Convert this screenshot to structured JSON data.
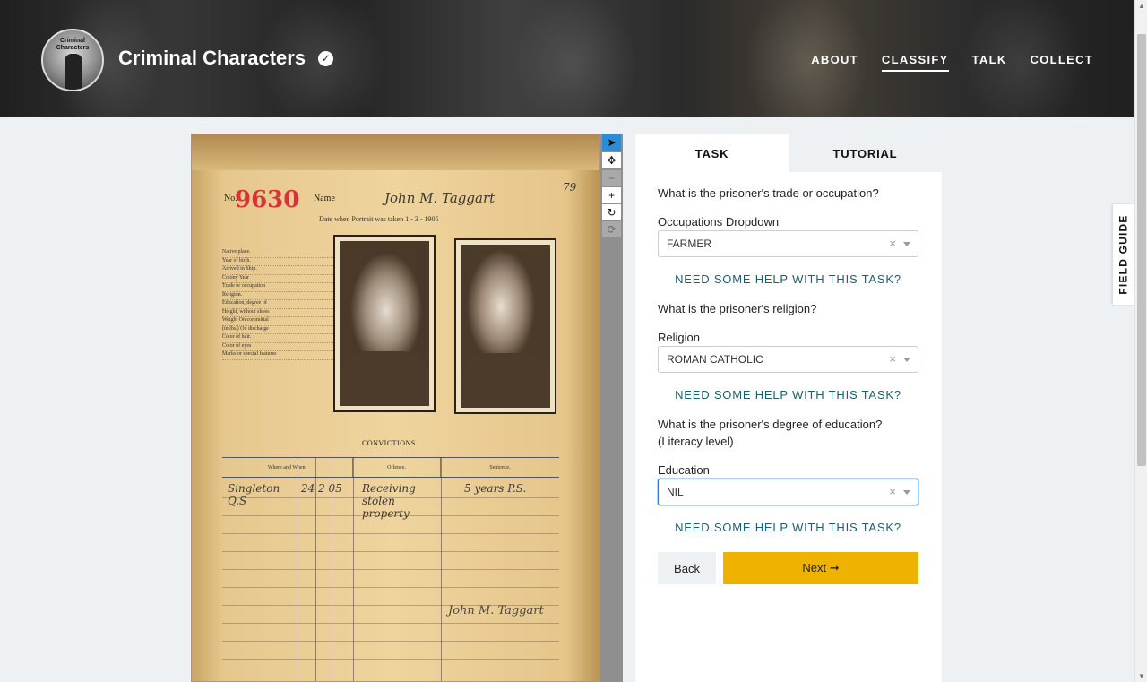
{
  "header": {
    "project_title": "Criminal Characters",
    "logo_text": "Criminal Characters",
    "nav": [
      {
        "label": "ABOUT"
      },
      {
        "label": "CLASSIFY"
      },
      {
        "label": "TALK"
      },
      {
        "label": "COLLECT"
      }
    ]
  },
  "subject": {
    "no_label": "No.",
    "register_number": "9630",
    "name_label": "Name",
    "handwritten_name": "John M. Taggart",
    "page_number": "79",
    "date_line": "Date when Portrait was taken  1 - 3 - 1905",
    "form_fields": [
      "Native place.",
      "Year of birth.",
      "Arrived in Ship.",
      "Colony  Year",
      "Trade or occupation",
      "Religion.",
      "Education, degree of",
      "Height, without shoes",
      "Weight On committal",
      "(in lbs.) On discharge",
      "Color of hair.",
      "Color of eyes",
      "Marks or special features"
    ],
    "convictions_heading": "CONVICTIONS.",
    "table_headers": [
      "Where and When.",
      "Offence.",
      "Sentence."
    ],
    "conviction_place": "Singleton Q.S",
    "conviction_date": "24  2  05",
    "conviction_offence": "Receiving stolen property",
    "conviction_sentence": "5 years P.S.",
    "signature": "John M. Taggart"
  },
  "toolbar": {
    "tools": [
      {
        "icon": "pointer-icon",
        "glyph": "➤"
      },
      {
        "icon": "move-icon",
        "glyph": "✥"
      },
      {
        "icon": "zoom-out-icon",
        "glyph": "−"
      },
      {
        "icon": "zoom-in-icon",
        "glyph": "+"
      },
      {
        "icon": "rotate-icon",
        "glyph": "↻"
      },
      {
        "icon": "reset-icon",
        "glyph": "⟳"
      }
    ]
  },
  "panel": {
    "tabs": [
      {
        "label": "TASK"
      },
      {
        "label": "TUTORIAL"
      }
    ],
    "q1": "What is the prisoner's trade or occupation?",
    "q1_dropdown_label": "Occupations Dropdown",
    "q1_value": "FARMER",
    "q2": "What is the prisoner's religion?",
    "q2_dropdown_label": "Religion",
    "q2_value": "ROMAN CATHOLIC",
    "q3": "What is the prisoner's degree of education? (Literacy level)",
    "q3_dropdown_label": "Education",
    "q3_value": "NIL",
    "help_label": "NEED SOME HELP WITH THIS TASK?",
    "clear_glyph": "×",
    "back_label": "Back",
    "next_label": "Next ➞"
  },
  "field_guide": {
    "label": "FIELD GUIDE"
  },
  "colors": {
    "accent": "#f0b200",
    "help_link": "#1f5f6b",
    "focus": "#2f7bd9",
    "tool_selected": "#2b8dd6"
  }
}
